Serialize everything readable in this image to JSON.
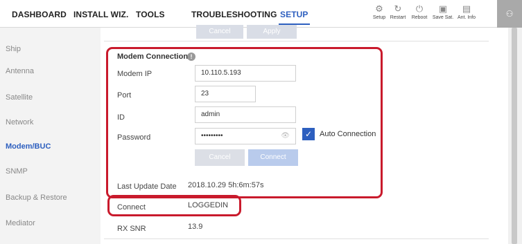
{
  "nav": {
    "items": [
      "DASHBOARD",
      "INSTALL WIZ.",
      "TOOLS",
      "TROUBLESHOOTING",
      "SETUP"
    ],
    "active": "SETUP"
  },
  "tools": [
    {
      "label": "Setup",
      "icon": "gear-icon",
      "glyph": "⚙"
    },
    {
      "label": "Restart",
      "icon": "restart-icon",
      "glyph": "↻"
    },
    {
      "label": "Reboot",
      "icon": "power-icon",
      "glyph": "⏻"
    },
    {
      "label": "Save Sat.",
      "icon": "save-icon",
      "glyph": "▣"
    },
    {
      "label": "Ant. Info",
      "icon": "antenna-info-icon",
      "glyph": "▤"
    }
  ],
  "user_glyph": "⚇",
  "sidebar": {
    "items": [
      "Ship",
      "Antenna",
      "Satellite",
      "Network",
      "Modem/BUC",
      "SNMP",
      "Backup & Restore",
      "Mediator"
    ],
    "active": "Modem/BUC"
  },
  "ghost_buttons": {
    "cancel": "Cancel",
    "apply": "Apply"
  },
  "modem": {
    "title": "Modem Connection",
    "info_glyph": "!",
    "fields": [
      {
        "label": "Modem IP",
        "value": "10.110.5.193"
      },
      {
        "label": "Port",
        "value": "23"
      },
      {
        "label": "ID",
        "value": "admin"
      },
      {
        "label": "Password",
        "value": "•••••••••"
      }
    ],
    "auto_connection_label": "Auto Connection",
    "auto_connection_checked": true,
    "check_glyph": "✓",
    "eye_glyph": "👁",
    "cancel_label": "Cancel",
    "connect_label": "Connect"
  },
  "status": {
    "last_update_label": "Last Update Date",
    "last_update_value": "2018.10.29 5h:6m:57s",
    "connect_label": "Connect",
    "connect_value": "LOGGEDIN",
    "rx_snr_label": "RX SNR",
    "rx_snr_value": "13.9"
  },
  "colors": {
    "accent": "#2d5fbf",
    "highlight": "#c91a2c",
    "sidebar_bg": "#f3f3f3"
  }
}
